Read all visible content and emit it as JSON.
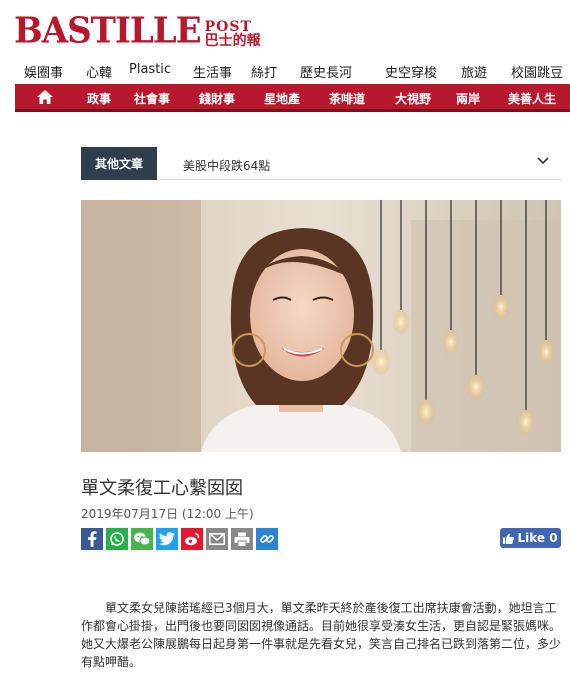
{
  "logo": {
    "main": "BASTILLE",
    "post": "POST",
    "cn": "巴士的報"
  },
  "topnav": [
    "娛圈事",
    "心韓",
    "Plastic",
    "生活事",
    "絲打",
    "歷史長河",
    "史空穿梭",
    "旅遊",
    "校園跳豆"
  ],
  "rednav": [
    "政事",
    "社會事",
    "錢財事",
    "星地產",
    "茶啡道",
    "大視野",
    "兩岸",
    "美善人生"
  ],
  "other_articles": {
    "tag": "其他文章",
    "headline": "美股中段跌64點"
  },
  "article": {
    "title": "單文柔復工心繫囡囡",
    "date": "2019年07月17日 (12:00 上午)",
    "like_label": "Like 0",
    "body": "單文柔女兒陳諾瑤經已3個月大，單文柔昨天終於產後復工出席扶康會活動，她坦言工作都會心掛掛，出門後也要同囡囡視像通話。目前她很享受湊女生活，更自認是緊張媽咪。她又大爆老公陳展鵬每日起身第一件事就是先看女兒，笑言自己排名已跌到落第二位，多少有點呷醋。"
  },
  "share_icons": [
    "facebook-icon",
    "whatsapp-icon",
    "wechat-icon",
    "twitter-icon",
    "weibo-icon",
    "email-icon",
    "print-icon",
    "link-icon"
  ],
  "colors": {
    "brand": "#b8182d",
    "tag_bg": "#2f3e4e",
    "like_bg": "#4267b2"
  }
}
